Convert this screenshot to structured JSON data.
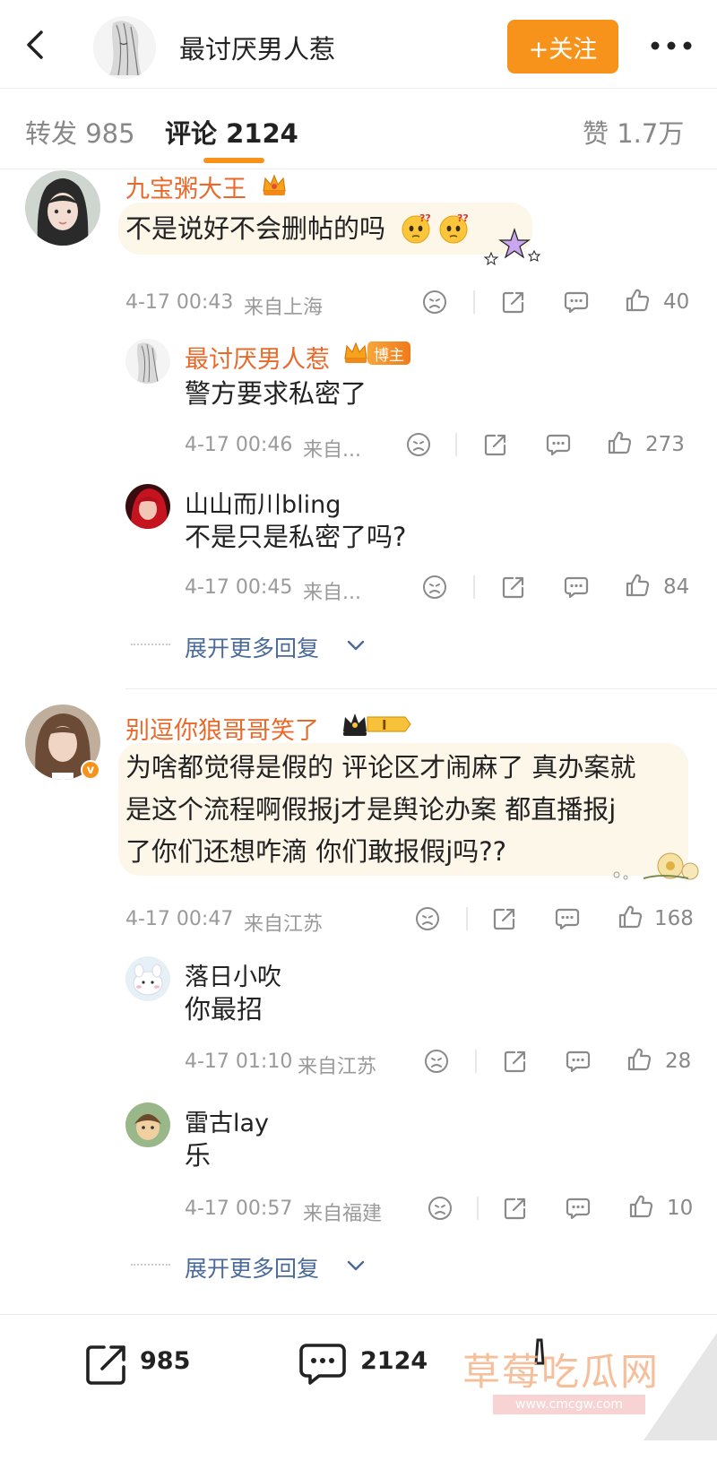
{
  "header": {
    "name": "最讨厌男人惹",
    "follow_label": "+关注"
  },
  "tabs": [
    {
      "label": "转发 985"
    },
    {
      "label": "评论 2124"
    },
    {
      "label": "赞 1.7万"
    }
  ],
  "comments": [
    {
      "name": "九宝粥大王",
      "text": "不是说好不会删帖的吗",
      "time": "4-17 00:43",
      "location": "来自上海",
      "likes": "40",
      "replies": [
        {
          "name": "最讨厌男人惹",
          "badge": "博主",
          "text": "警方要求私密了",
          "time": "4-17 00:46",
          "location": "来自...",
          "likes": "273"
        },
        {
          "name": "山山而川bling",
          "text": "不是只是私密了吗?",
          "time": "4-17 00:45",
          "location": "来自...",
          "likes": "84"
        }
      ],
      "expand_label": "展开更多回复"
    },
    {
      "name": "别逗你狼哥哥笑了",
      "text_lines": [
        "为啥都觉得是假的 评论区才闹麻了 真办案就",
        "是这个流程啊假报j才是舆论办案 都直播报j",
        "了你们还想咋滴 你们敢报假j吗??"
      ],
      "time": "4-17 00:47",
      "location": "来自江苏",
      "likes": "168",
      "replies": [
        {
          "name": "落日小吹",
          "text": "你最招",
          "time": "4-17 01:10",
          "location": "来自江苏",
          "likes": "28"
        },
        {
          "name": "雷古lay",
          "text": "乐",
          "time": "4-17 00:57",
          "location": "来自福建",
          "likes": "10"
        }
      ],
      "expand_label": "展开更多回复"
    }
  ],
  "bottom_bar": {
    "repost_count": "985",
    "comment_count": "2124"
  },
  "watermark": {
    "text": "草莓吃瓜网",
    "url": "www.cmcgw.com"
  },
  "colors": {
    "accent": "#f7931a",
    "vip_name": "#e8692a",
    "link": "#4a6a9a"
  }
}
